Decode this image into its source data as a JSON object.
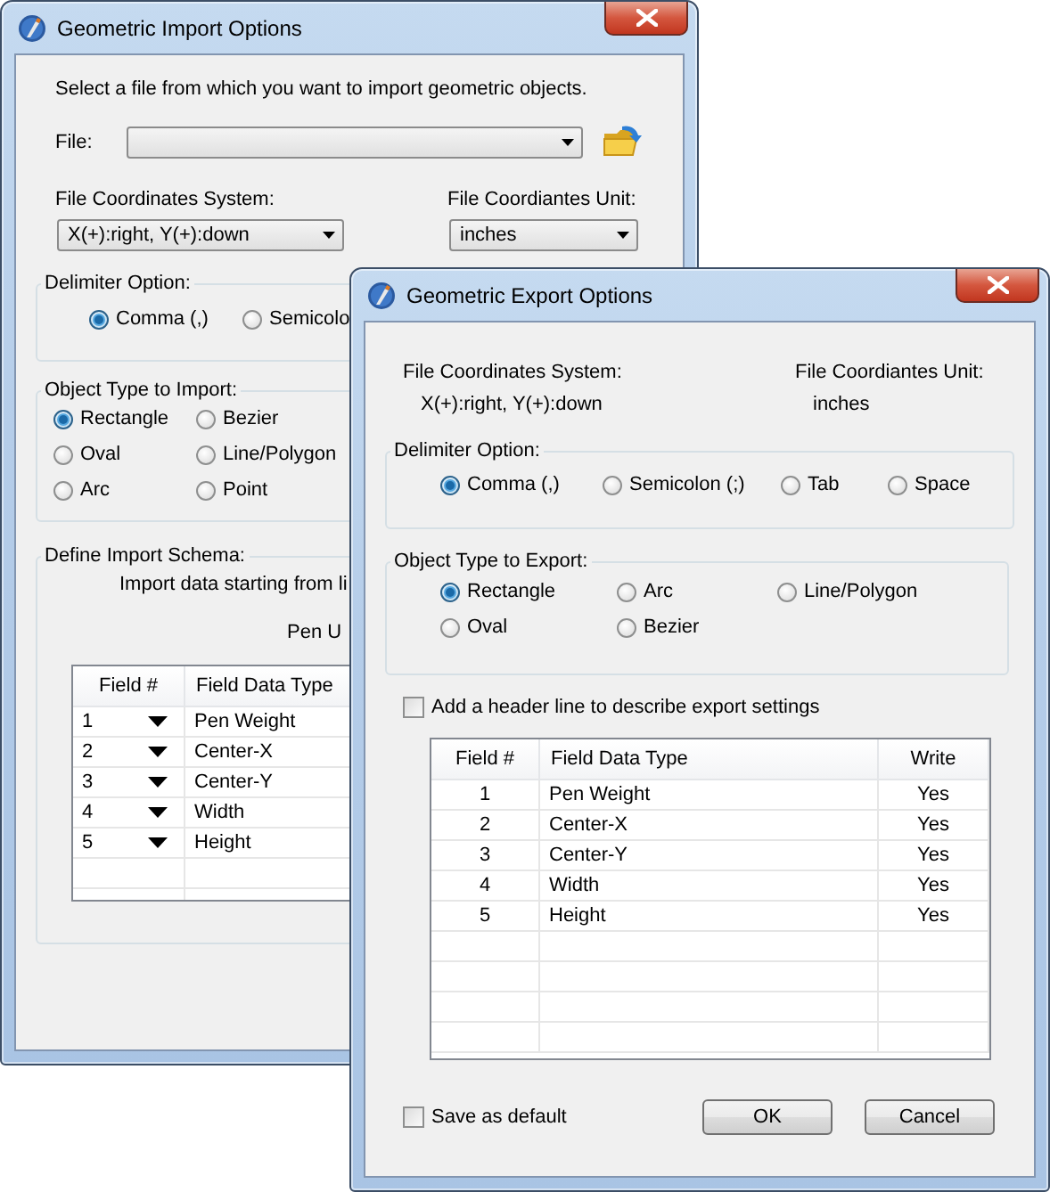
{
  "import_dialog": {
    "title": "Geometric Import Options",
    "instruction": "Select a file from which you want to import geometric objects.",
    "file": {
      "label": "File:"
    },
    "coordinate_system": {
      "label": "File Coordinates System:",
      "value": "X(+):right, Y(+):down"
    },
    "coordinate_unit": {
      "label": "File Coordiantes Unit:",
      "value": "inches"
    },
    "delimiter": {
      "title": "Delimiter Option:",
      "options": [
        {
          "label": "Comma (,)",
          "selected": true
        },
        {
          "label": "Semicolo",
          "selected": false
        }
      ]
    },
    "object_type": {
      "title": "Object Type to Import:",
      "options": [
        {
          "label": "Rectangle",
          "selected": true
        },
        {
          "label": "Bezier",
          "selected": false
        },
        {
          "label": "Oval",
          "selected": false
        },
        {
          "label": "Line/Polygon",
          "selected": false
        },
        {
          "label": "Arc",
          "selected": false
        },
        {
          "label": "Point",
          "selected": false
        }
      ]
    },
    "schema": {
      "title": "Define Import Schema:",
      "start_text": "Import data starting from li",
      "pen_text": "Pen U",
      "table": {
        "columns": [
          "Field #",
          "Field Data Type"
        ],
        "rows": [
          {
            "field": "1",
            "type": "Pen Weight"
          },
          {
            "field": "2",
            "type": "Center-X"
          },
          {
            "field": "3",
            "type": "Center-Y"
          },
          {
            "field": "4",
            "type": "Width"
          },
          {
            "field": "5",
            "type": "Height"
          }
        ]
      }
    }
  },
  "export_dialog": {
    "title": "Geometric Export Options",
    "coordinate_system": {
      "label": "File Coordinates System:",
      "value": "X(+):right, Y(+):down"
    },
    "coordinate_unit": {
      "label": "File Coordiantes Unit:",
      "value": "inches"
    },
    "delimiter": {
      "title": "Delimiter Option:",
      "options": [
        {
          "label": "Comma (,)",
          "selected": true
        },
        {
          "label": "Semicolon (;)",
          "selected": false
        },
        {
          "label": "Tab",
          "selected": false
        },
        {
          "label": "Space",
          "selected": false
        }
      ]
    },
    "object_type": {
      "title": "Object Type to Export:",
      "options": [
        {
          "label": "Rectangle",
          "selected": true
        },
        {
          "label": "Arc",
          "selected": false
        },
        {
          "label": "Line/Polygon",
          "selected": false
        },
        {
          "label": "Oval",
          "selected": false
        },
        {
          "label": "Bezier",
          "selected": false
        }
      ]
    },
    "header_line": {
      "label": "Add a header line to describe export settings",
      "checked": false
    },
    "table": {
      "columns": [
        "Field #",
        "Field Data Type",
        "Write"
      ],
      "rows": [
        {
          "field": "1",
          "type": "Pen Weight",
          "write": "Yes"
        },
        {
          "field": "2",
          "type": "Center-X",
          "write": "Yes"
        },
        {
          "field": "3",
          "type": "Center-Y",
          "write": "Yes"
        },
        {
          "field": "4",
          "type": "Width",
          "write": "Yes"
        },
        {
          "field": "5",
          "type": "Height",
          "write": "Yes"
        }
      ]
    },
    "save_default": {
      "label": "Save as default",
      "checked": false
    },
    "buttons": [
      "OK",
      "Cancel"
    ]
  }
}
